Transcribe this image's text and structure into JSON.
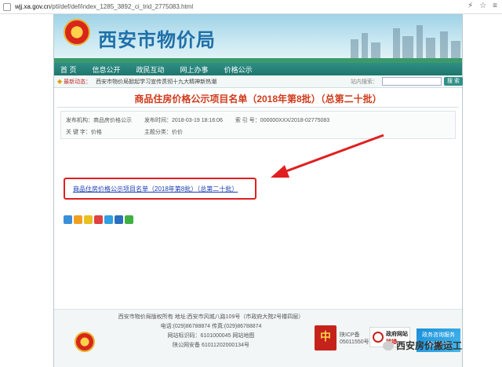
{
  "browser": {
    "url_domain": "wjj.xa.gov.cn",
    "url_path": "/ptl/def/def/index_1285_3892_ci_trid_2775083.html",
    "icons": [
      "flash-icon",
      "star-icon",
      "menu-icon"
    ]
  },
  "banner": {
    "title": "西安市物价局"
  },
  "nav": {
    "items": [
      "首 页",
      "信息公开",
      "政民互动",
      "网上办事",
      "价格公示"
    ]
  },
  "news": {
    "label": "最新动态：",
    "text": "西安市物价局掀起学习宣传贯彻十九大精神新热潮",
    "search_label": "站内搜索：",
    "search_button": "搜 索"
  },
  "article": {
    "title": "商品住房价格公示项目名单（2018年第8批）（总第二十批）",
    "meta": {
      "publisher": "发布机构：商品房价格公示",
      "time": "发布时间：2018-03-19 18:16:06",
      "index": "索 引 号：000000XXX/2018-02775083",
      "keywords": "关 键 字：价格",
      "category": "主题分类：价价"
    },
    "link_text": "商品住房价格公示项目名单（2018年第8批）（总第二十批）"
  },
  "share": {
    "icons": [
      "share-qzone-icon",
      "share-mail-icon",
      "share-star-icon",
      "share-weibo-icon",
      "share-tqq-icon",
      "share-renren-icon",
      "share-wechat-icon"
    ],
    "colors": [
      "#3a8fd8",
      "#f0a020",
      "#e8c020",
      "#e04040",
      "#30a0e0",
      "#2a6fc0",
      "#40b040"
    ]
  },
  "footer": {
    "line1": "西安市物价局版权所有 地址:西安市风城八路109号（市政府大院2号楼四层）",
    "line2": "电话:(029)86788874 传真:(029)86788874",
    "line3": "网站标识码：6101000045  网站地图",
    "line4": "陕公网安备 61011202000134号",
    "party_badge": "中",
    "icp_line1": "陕ICP备",
    "icp_line2": "05011550号",
    "gov_badge_1": "政府网站",
    "gov_badge_2": "找错",
    "ad_line1": "政务咨询服务",
    "ad_line2": "投诉平台"
  },
  "watermark": {
    "text": "西安房价搬运工"
  }
}
